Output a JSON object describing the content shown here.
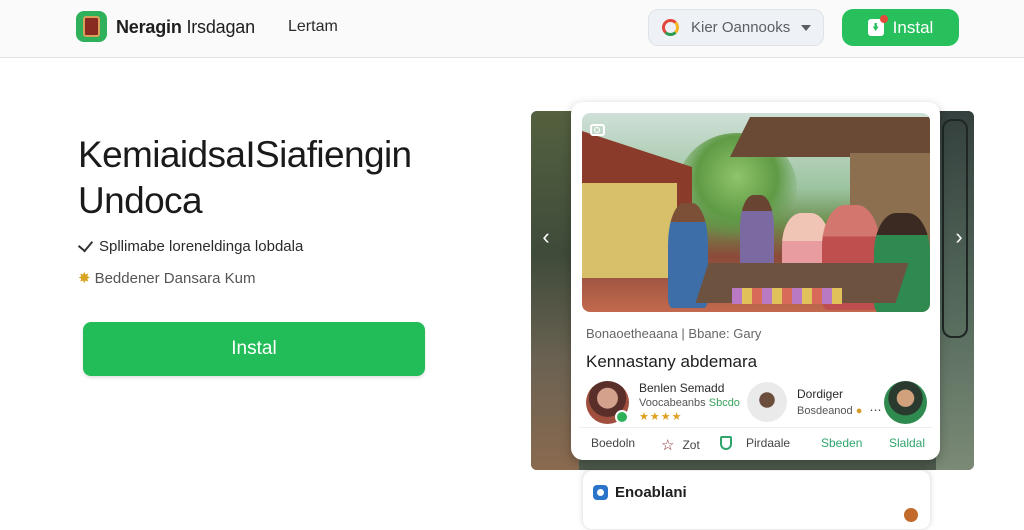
{
  "header": {
    "brand_primary": "Neragin",
    "brand_secondary": "Irsdagan",
    "nav_link": "Lertam",
    "language_select": {
      "selected": "Kier Oannooks",
      "icon": "google-icon"
    },
    "install_label": "Instal"
  },
  "hero": {
    "title_line1": "KemiaidsaISiafiengin",
    "title_line2": "Undoca",
    "feature_1": "Spllimabe loreneldinga lobdala",
    "feature_2": "Beddener Dansara Kum",
    "install_label": "Instal",
    "colors": {
      "accent_green": "#22bc58"
    }
  },
  "preview": {
    "nav_prev_icon": "chevron-left-icon",
    "nav_next_icon": "chevron-right-icon",
    "card": {
      "meta": "Bonaoetheaana | Bbane: Gary",
      "title": "Kennastany abdemara",
      "sellers": [
        {
          "name": "Benlen Semadd",
          "sub_prefix": "Voocabeanbs",
          "sub_accent": "Sbcdo",
          "rating_text": "★★★★"
        },
        {
          "name": "Dordiger",
          "sub": "Bosdeanod"
        },
        {
          "label": "Slaldal"
        }
      ],
      "tabs": [
        {
          "label": "Boedoln"
        },
        {
          "label": "Zot"
        },
        {
          "label": "Pirdaale"
        },
        {
          "label": "Sbeden"
        },
        {
          "label": "Slaldal"
        }
      ]
    },
    "card2": {
      "title": "Enoablani"
    }
  }
}
